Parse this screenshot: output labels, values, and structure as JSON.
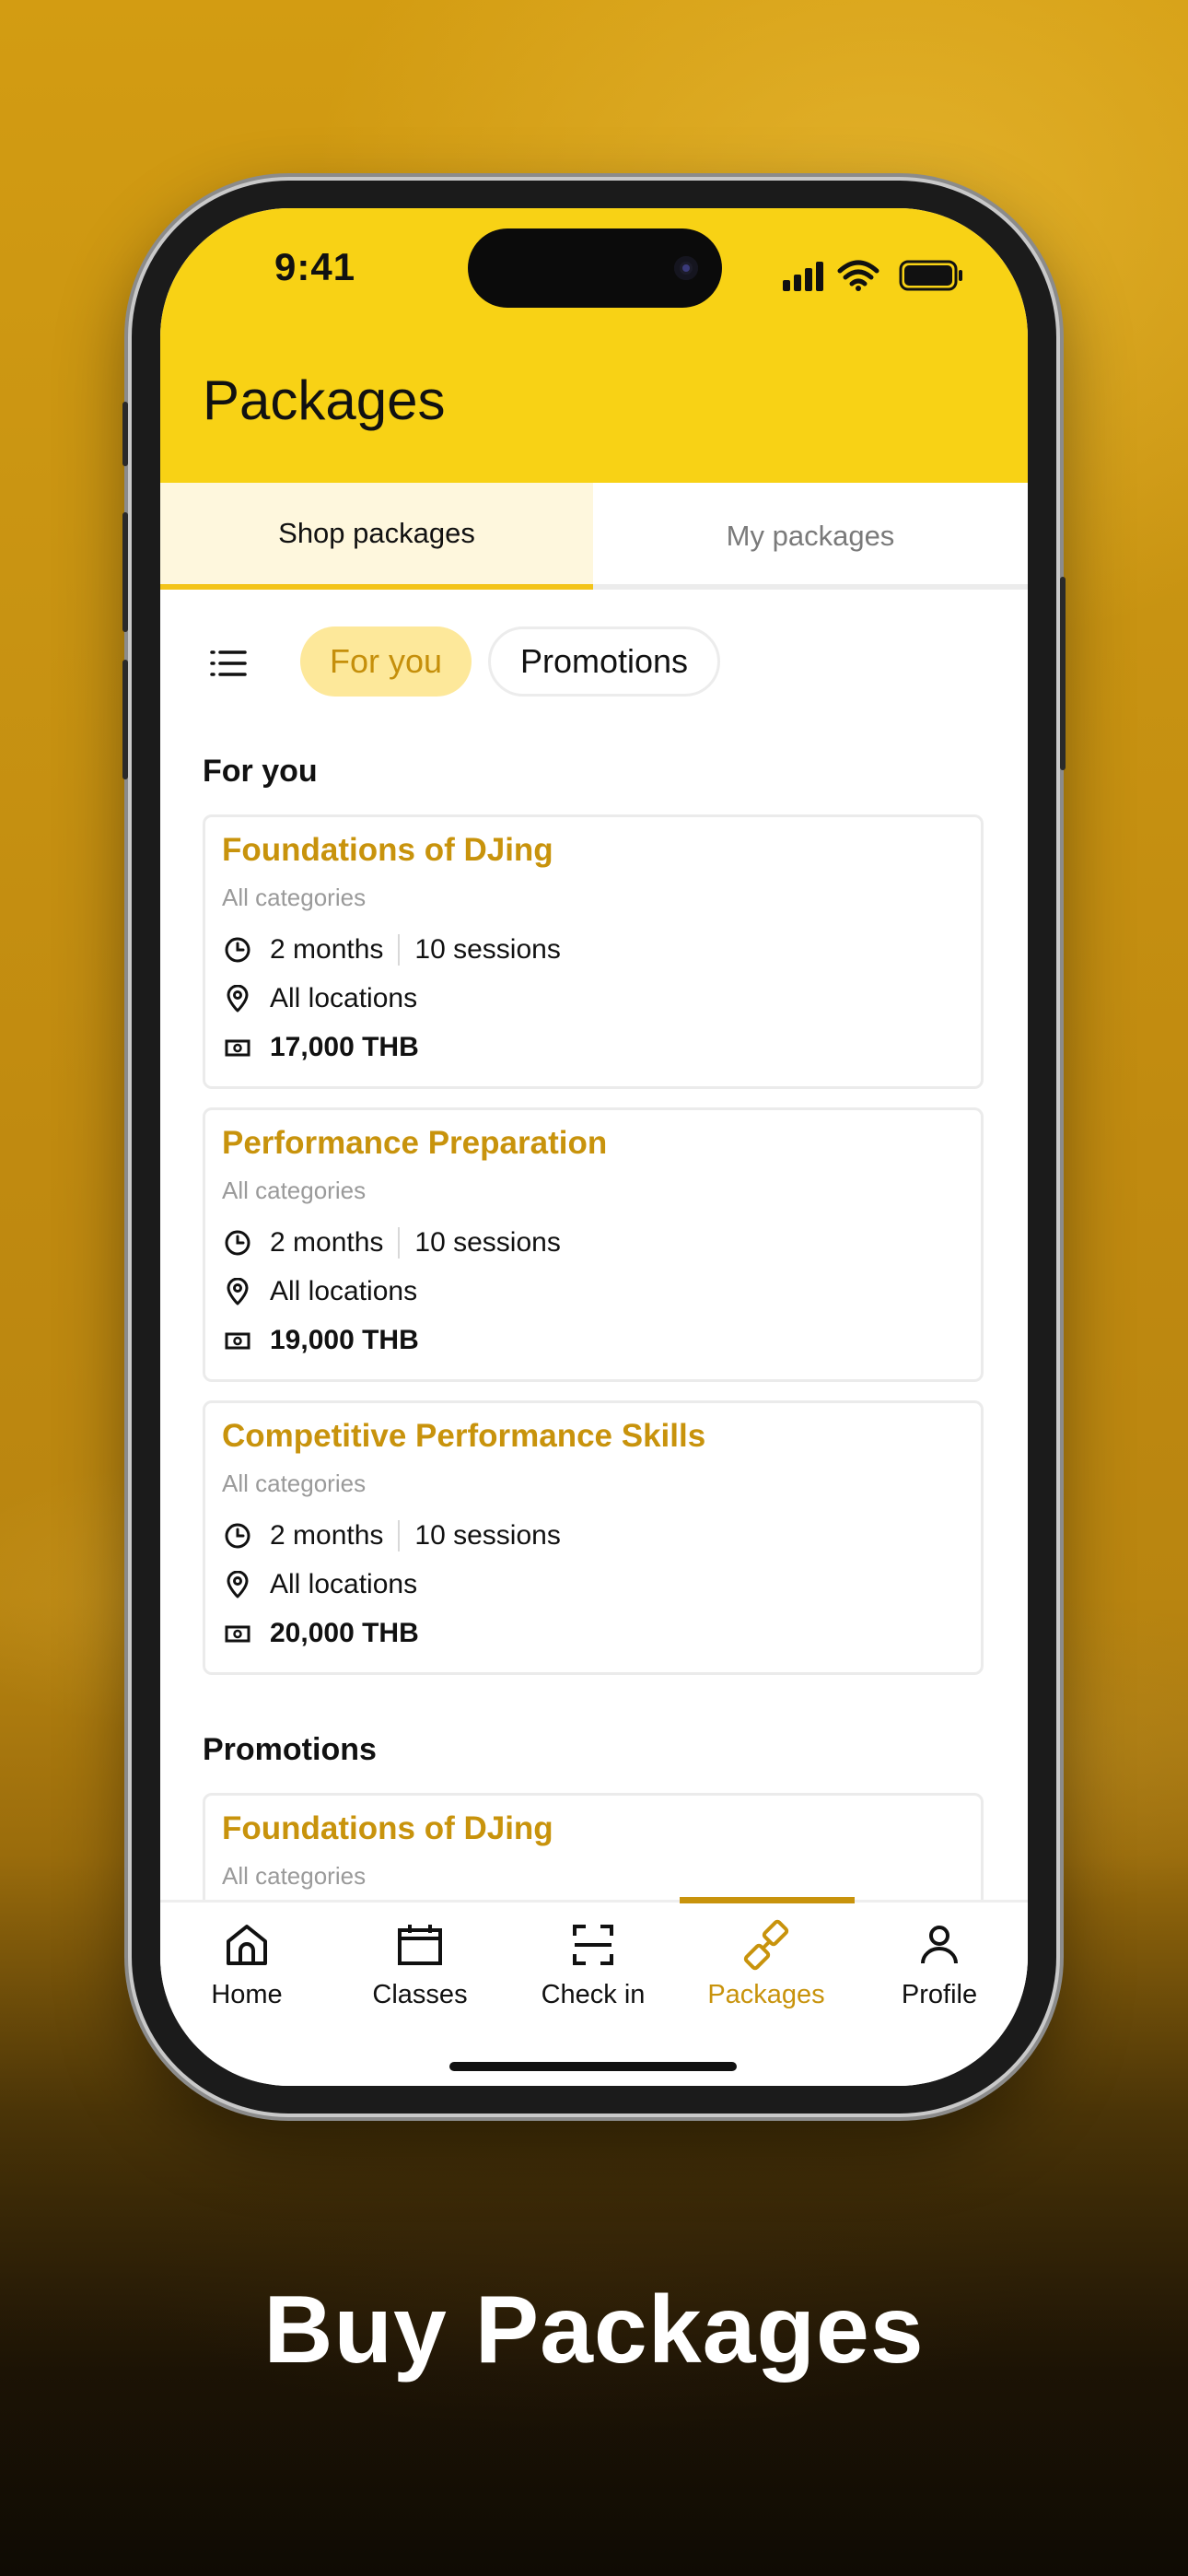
{
  "status_bar": {
    "time": "9:41"
  },
  "header": {
    "title": "Packages"
  },
  "tabs": [
    {
      "label": "Shop packages",
      "active": true
    },
    {
      "label": "My packages",
      "active": false
    }
  ],
  "filters": {
    "icon": "list-filter-icon",
    "chips": [
      {
        "label": "For you",
        "selected": true
      },
      {
        "label": "Promotions",
        "selected": false
      }
    ]
  },
  "sections": {
    "for_you": {
      "title": "For you",
      "cards": [
        {
          "title": "Foundations of DJing",
          "category": "All categories",
          "duration": "2 months",
          "sessions": "10 sessions",
          "location": "All locations",
          "price": "17,000 THB"
        },
        {
          "title": "Performance Preparation",
          "category": "All categories",
          "duration": "2 months",
          "sessions": "10 sessions",
          "location": "All locations",
          "price": "19,000 THB"
        },
        {
          "title": "Competitive Performance Skills",
          "category": "All categories",
          "duration": "2 months",
          "sessions": "10 sessions",
          "location": "All locations",
          "price": "20,000 THB"
        }
      ]
    },
    "promotions": {
      "title": "Promotions",
      "cards": [
        {
          "title": "Foundations of DJing",
          "category": "All categories"
        }
      ]
    }
  },
  "bottom_nav": [
    {
      "label": "Home",
      "icon": "home-icon",
      "active": false
    },
    {
      "label": "Classes",
      "icon": "calendar-icon",
      "active": false
    },
    {
      "label": "Check in",
      "icon": "scan-icon",
      "active": false
    },
    {
      "label": "Packages",
      "icon": "package-icon",
      "active": true
    },
    {
      "label": "Profile",
      "icon": "person-icon",
      "active": false
    }
  ],
  "caption": "Buy Packages",
  "colors": {
    "accent": "#f8d215",
    "gold_text": "#c8930c",
    "chip_bg": "#fde89a"
  }
}
